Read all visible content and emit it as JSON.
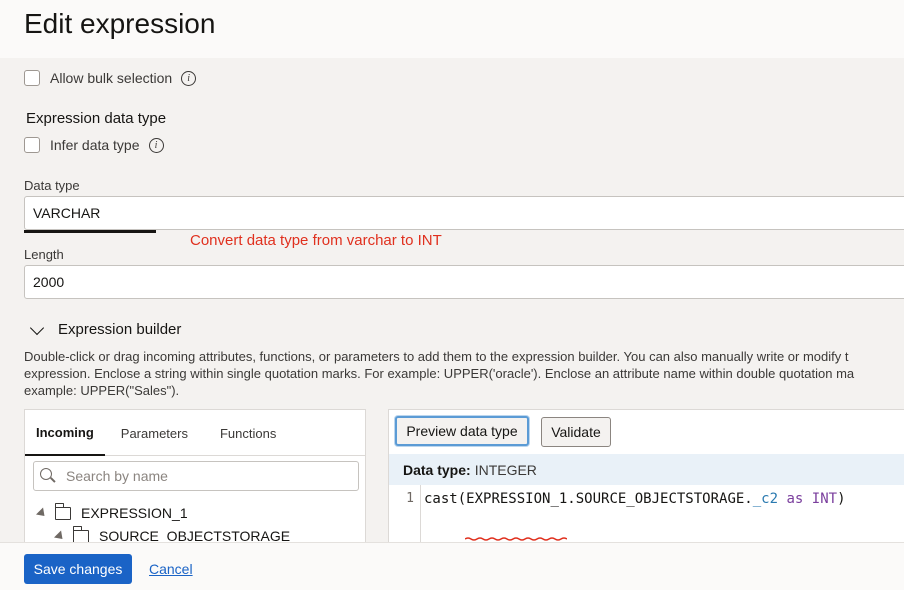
{
  "dialog": {
    "title": "Edit expression"
  },
  "bulk": {
    "label": "Allow bulk selection"
  },
  "expr_type": {
    "heading": "Expression data type",
    "infer_label": "Infer data type",
    "data_type_label": "Data type",
    "data_type_value": "VARCHAR",
    "length_label": "Length",
    "length_value": "2000"
  },
  "annotation": {
    "text": "Convert data type from varchar to INT",
    "color": "#e0301e"
  },
  "builder": {
    "heading": "Expression builder",
    "desc_lines": [
      "Double-click or drag incoming attributes, functions, or parameters to add them to the expression builder. You can also manually write or modify t",
      "expression. Enclose a string within single quotation marks. For example: UPPER('oracle'). Enclose an attribute name within double quotation ma",
      "example: UPPER(\"Sales\")."
    ],
    "tabs": [
      "Incoming",
      "Parameters",
      "Functions"
    ],
    "search_placeholder": "Search by name",
    "tree": [
      "EXPRESSION_1",
      "SOURCE_OBJECTSTORAGE"
    ],
    "preview_label": "Preview data type",
    "validate_label": "Validate",
    "dtype_key": "Data type:",
    "dtype_value": "INTEGER",
    "line_number": "1",
    "code": {
      "fn": "cast",
      "open": "(",
      "ref": "EXPRESSION_1.SOURCE_OBJECTSTORAGE.",
      "col": "_c2",
      "as": "as",
      "type": "INT",
      "close": ")"
    }
  },
  "footer": {
    "save_label": "Save changes",
    "cancel_label": "Cancel"
  },
  "colors": {
    "primary": "#1a63c6",
    "annotation": "#e0301e",
    "keyword": "#7a3e9d",
    "column": "#2a7ab0"
  }
}
